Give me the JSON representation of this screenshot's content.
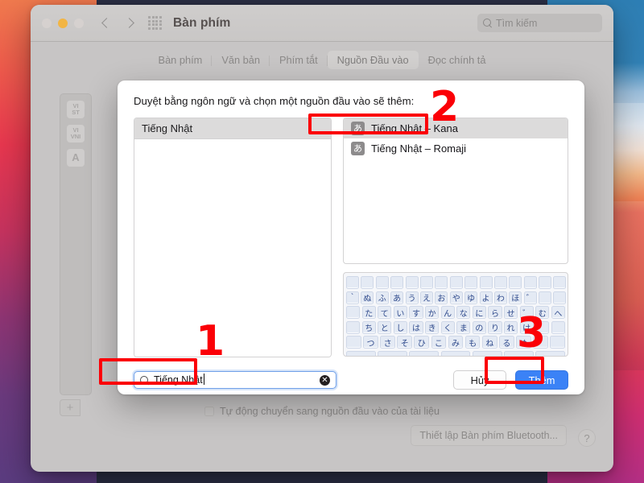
{
  "window": {
    "title": "Bàn phím",
    "traffic_lights": [
      "close",
      "minimize",
      "zoom"
    ],
    "nav_back_icon": "chevron-left-icon",
    "nav_forward_icon": "chevron-right-icon",
    "grid_icon": "grid-apps-icon",
    "search": {
      "icon": "search-icon",
      "placeholder": "Tìm kiếm",
      "value": ""
    }
  },
  "tabs": [
    {
      "label": "Bàn phím",
      "selected": false
    },
    {
      "label": "Văn bản",
      "selected": false
    },
    {
      "label": "Phím tắt",
      "selected": false
    },
    {
      "label": "Nguồn Đầu vào",
      "selected": true
    },
    {
      "label": "Đọc chính tả",
      "selected": false
    }
  ],
  "background_pane": {
    "input_sources": [
      {
        "line1": "VI",
        "line2": "ST"
      },
      {
        "line1": "VI",
        "line2": "VNI"
      },
      {
        "line1": "A",
        "line2": ""
      }
    ],
    "add_button_label": "+",
    "auto_switch_label": "Tự động chuyển sang nguồn đầu vào của tài liệu",
    "auto_switch_checked": false,
    "bluetooth_button_label": "Thiết lập Bàn phím Bluetooth...",
    "help_button_label": "?"
  },
  "sheet": {
    "title": "Duyệt bằng ngôn ngữ và chọn một nguồn đầu vào sẽ thêm:",
    "language_column": {
      "header": "Tiếng Nhật",
      "items": []
    },
    "source_column": {
      "items": [
        {
          "badge": "あ",
          "label": "Tiếng Nhật – Kana",
          "selected": true
        },
        {
          "badge": "あ",
          "label": "Tiếng Nhật – Romaji",
          "selected": false
        }
      ]
    },
    "keyboard_preview": {
      "rows": [
        [
          "",
          "",
          "",
          "",
          "",
          "",
          "",
          "",
          "",
          "",
          "",
          "",
          "",
          "",
          ""
        ],
        [
          "`",
          "ぬ",
          "ふ",
          "あ",
          "う",
          "え",
          "お",
          "や",
          "ゆ",
          "よ",
          "わ",
          "ほ",
          "゛",
          "",
          ""
        ],
        [
          "",
          "た",
          "て",
          "い",
          "す",
          "か",
          "ん",
          "な",
          "に",
          "ら",
          "せ",
          "゛",
          "む",
          "へ"
        ],
        [
          "",
          "ち",
          "と",
          "し",
          "は",
          "き",
          "く",
          "ま",
          "の",
          "り",
          "れ",
          "け",
          "",
          ""
        ],
        [
          "",
          "つ",
          "さ",
          "そ",
          "ひ",
          "こ",
          "み",
          "も",
          "ね",
          "る",
          "め",
          "",
          ""
        ],
        [
          "",
          "",
          "",
          "",
          "",
          "",
          ""
        ]
      ]
    },
    "search_field": {
      "icon": "search-icon",
      "value": "Tiếng Nhật",
      "clear_icon": "clear-circle-icon"
    },
    "cancel_label": "Hủy",
    "add_label": "Thêm"
  },
  "annotations": {
    "accent_color": "#fb0007",
    "steps": [
      {
        "number": "1",
        "target": "search-field"
      },
      {
        "number": "2",
        "target": "kana-source-row"
      },
      {
        "number": "3",
        "target": "add-button"
      }
    ]
  }
}
